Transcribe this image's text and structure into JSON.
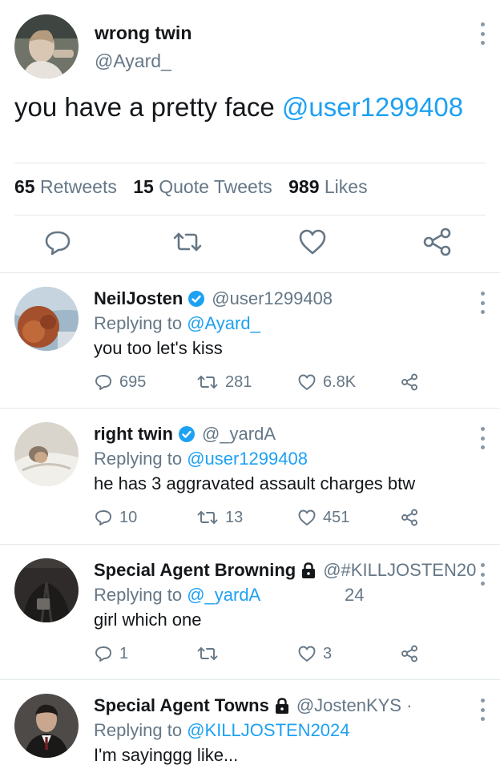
{
  "main_tweet": {
    "author_name": "wrong twin",
    "author_handle": "@Ayard_",
    "text_plain": "you have a pretty face ",
    "text_mention": "@user1299408",
    "stats": {
      "retweets_count": "65",
      "retweets_label": "Retweets",
      "quotes_count": "15",
      "quotes_label": "Quote Tweets",
      "likes_count": "989",
      "likes_label": "Likes"
    }
  },
  "replies": [
    {
      "name": "NeilJosten",
      "verified": true,
      "locked": false,
      "handle": "@user1299408",
      "replying_prefix": "Replying to ",
      "replying_to": "@Ayard_",
      "text": "you too let's kiss",
      "replies": "695",
      "retweets": "281",
      "likes": "6.8K"
    },
    {
      "name": "right twin",
      "verified": true,
      "locked": false,
      "handle": "@_yardA",
      "replying_prefix": "Replying to ",
      "replying_to": "@user1299408",
      "text": "he has 3 aggravated assault charges btw",
      "replies": "10",
      "retweets": "13",
      "likes": "451"
    },
    {
      "name": "Special Agent Browning",
      "verified": false,
      "locked": true,
      "handle": "@#KILLJOSTEN20",
      "handle_wrap": "24",
      "replying_prefix": "Replying to ",
      "replying_to": "@_yardA",
      "text": "girl which one",
      "replies": "1",
      "retweets": "",
      "likes": "3"
    },
    {
      "name": "Special Agent Towns",
      "verified": false,
      "locked": true,
      "handle": "@JostenKYS ·",
      "replying_prefix": "Replying to ",
      "replying_to": "@KILLJOSTEN2024",
      "text": "I'm sayinggg like...",
      "replies": "",
      "retweets": "",
      "likes": ""
    }
  ],
  "icons": {
    "reply": "reply-icon",
    "retweet": "retweet-icon",
    "like": "heart-icon",
    "share": "share-icon",
    "more": "more-vertical-icon",
    "verified": "verified-badge-icon",
    "protected": "lock-icon"
  },
  "colors": {
    "accent": "#1da1f2",
    "secondary_text": "#657786",
    "primary_text": "#14171a",
    "divider": "#e1e8ed"
  }
}
